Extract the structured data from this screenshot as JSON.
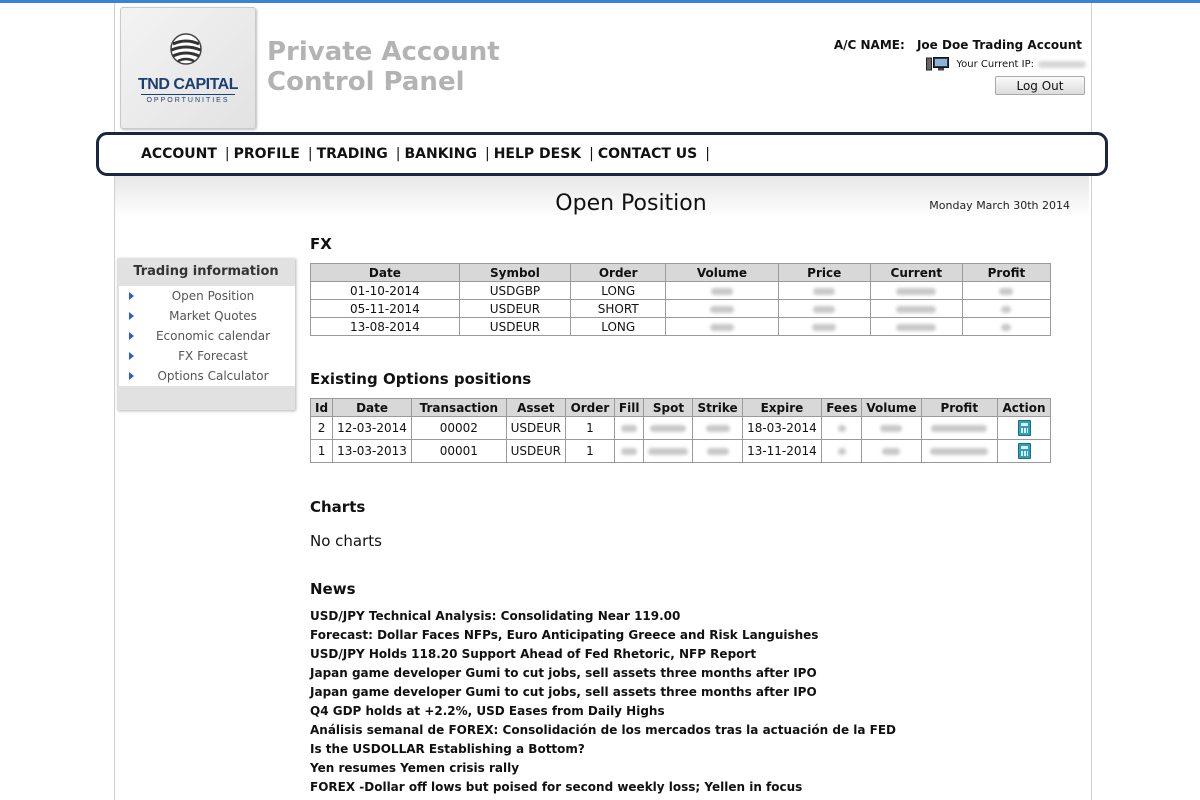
{
  "brand": {
    "logo_name": "TND CAPITAL",
    "logo_sub": "OPPORTUNITIES",
    "panel_title_line1": "Private Account",
    "panel_title_line2": "Control Panel"
  },
  "account": {
    "name_label": "A/C NAME:",
    "name_value": "Joe Doe Trading Account",
    "ip_label": "Your Current IP:",
    "logout_label": "Log Out"
  },
  "nav": {
    "items": [
      {
        "label": "ACCOUNT"
      },
      {
        "label": "PROFILE"
      },
      {
        "label": "TRADING"
      },
      {
        "label": "BANKING"
      },
      {
        "label": "HELP DESK"
      },
      {
        "label": "CONTACT US"
      }
    ],
    "separator": "|"
  },
  "page": {
    "title": "Open Position",
    "date": "Monday March 30th 2014"
  },
  "sidebar": {
    "heading": "Trading information",
    "items": [
      {
        "label": "Open Position"
      },
      {
        "label": "Market Quotes"
      },
      {
        "label": "Economic calendar"
      },
      {
        "label": "FX Forecast"
      },
      {
        "label": "Options Calculator"
      }
    ]
  },
  "fx": {
    "heading": "FX",
    "columns": [
      "Date",
      "Symbol",
      "Order",
      "Volume",
      "Price",
      "Current",
      "Profit"
    ],
    "rows": [
      {
        "date": "01-10-2014",
        "symbol": "USDGBP",
        "order": "LONG"
      },
      {
        "date": "05-11-2014",
        "symbol": "USDEUR",
        "order": "SHORT"
      },
      {
        "date": "13-08-2014",
        "symbol": "USDEUR",
        "order": "LONG"
      }
    ]
  },
  "options": {
    "heading": "Existing Options positions",
    "columns": [
      "Id",
      "Date",
      "Transaction",
      "Asset",
      "Order",
      "Fill",
      "Spot",
      "Strike",
      "Expire",
      "Fees",
      "Volume",
      "Profit",
      "Action"
    ],
    "rows": [
      {
        "id": "2",
        "date": "12-03-2014",
        "transaction": "00002",
        "asset": "USDEUR",
        "order": "1",
        "expire": "18-03-2014"
      },
      {
        "id": "1",
        "date": "13-03-2013",
        "transaction": "00001",
        "asset": "USDEUR",
        "order": "1",
        "expire": "13-11-2014"
      }
    ]
  },
  "charts": {
    "heading": "Charts",
    "empty_text": "No charts"
  },
  "news": {
    "heading": "News",
    "items": [
      "USD/JPY Technical Analysis: Consolidating Near 119.00",
      "Forecast: Dollar Faces NFPs, Euro Anticipating Greece and Risk Languishes",
      "USD/JPY Holds 118.20 Support Ahead of Fed Rhetoric, NFP Report",
      "Japan game developer Gumi to cut jobs, sell assets three months after IPO",
      "Japan game developer Gumi to cut jobs, sell assets three months after IPO",
      "Q4 GDP holds at +2.2%, USD Eases from Daily Highs",
      "Análisis semanal de FOREX: Consolidación de los mercados tras la actuación de la FED",
      "Is the USDOLLAR Establishing a Bottom?",
      "Yen resumes Yemen crisis rally",
      "FOREX -Dollar off lows but poised for second weekly loss; Yellen in focus"
    ]
  }
}
